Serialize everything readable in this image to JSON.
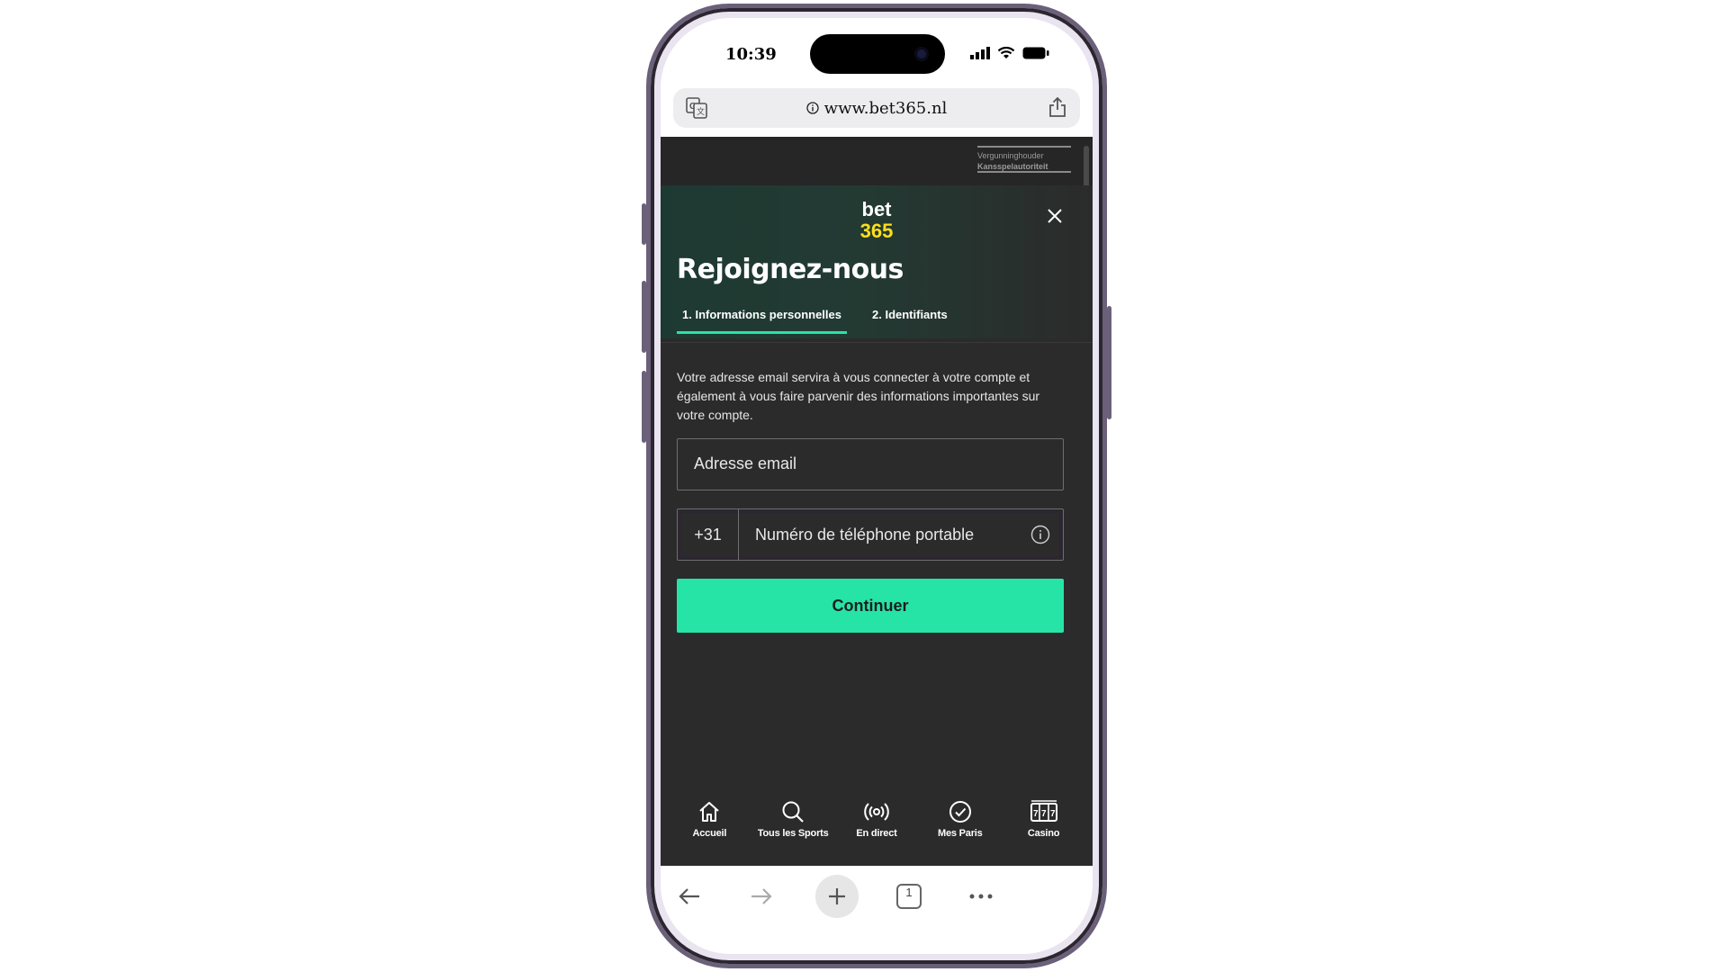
{
  "status_bar": {
    "time": "10:39"
  },
  "browser": {
    "url": "www.bet365.nl",
    "tab_count": "1"
  },
  "license": {
    "line1": "Vergunninghouder",
    "line2": "Kansspelautoriteit"
  },
  "brand": {
    "logo_top": "bet",
    "logo_bottom": "365"
  },
  "signup": {
    "title": "Rejoignez-nous",
    "tabs": [
      {
        "label": "1.  Informations personnelles",
        "active": true
      },
      {
        "label": "2.  Identifiants",
        "active": false
      }
    ],
    "info_text": "Votre adresse email servira à vous connecter à votre compte et également à vous faire parvenir des informations importantes sur votre compte.",
    "email_placeholder": "Adresse email",
    "phone_prefix": "+31",
    "phone_placeholder": "Numéro de téléphone portable",
    "continue_label": "Continuer"
  },
  "bottom_nav": [
    {
      "label": "Accueil",
      "icon": "home-icon"
    },
    {
      "label": "Tous les Sports",
      "icon": "search-icon"
    },
    {
      "label": "En direct",
      "icon": "live-broadcast-icon"
    },
    {
      "label": "Mes Paris",
      "icon": "check-circle-icon"
    },
    {
      "label": "Casino",
      "icon": "slot-machine-icon"
    }
  ],
  "colors": {
    "accent_green": "#26e4a6",
    "logo_yellow": "#ffdf1b",
    "background_dark": "#2b2b2b",
    "phone_frame": "#6b6079"
  }
}
